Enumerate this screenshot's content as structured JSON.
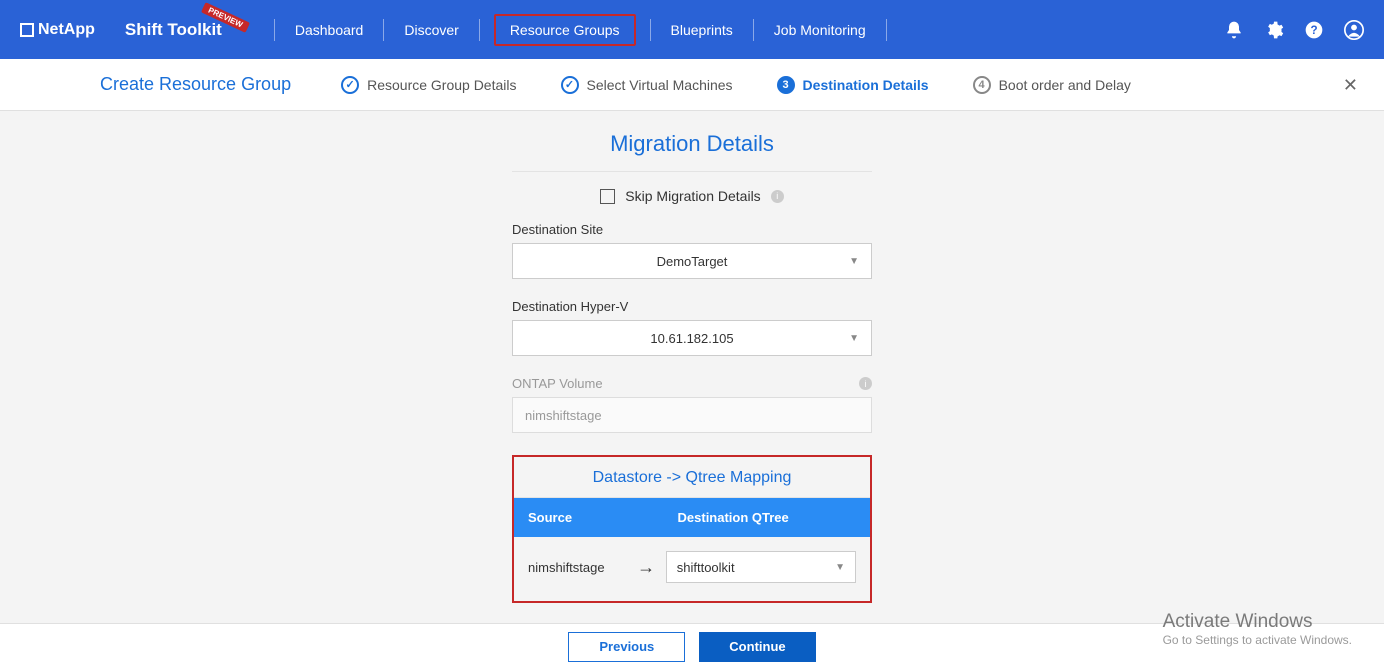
{
  "brand": {
    "company": "NetApp",
    "product": "Shift Toolkit",
    "ribbon": "PREVIEW"
  },
  "nav": {
    "dashboard": "Dashboard",
    "discover": "Discover",
    "resource_groups": "Resource Groups",
    "blueprints": "Blueprints",
    "job_monitoring": "Job Monitoring"
  },
  "wizard": {
    "title": "Create Resource Group",
    "steps": {
      "s1": "Resource Group Details",
      "s2": "Select Virtual Machines",
      "s3": "Destination Details",
      "s4": "Boot order and Delay",
      "n3": "3",
      "n4": "4"
    }
  },
  "panel": {
    "heading": "Migration Details",
    "skip_label": "Skip Migration Details",
    "dest_site_label": "Destination Site",
    "dest_site_value": "DemoTarget",
    "dest_hv_label": "Destination Hyper-V",
    "dest_hv_value": "10.61.182.105",
    "ontap_label": "ONTAP Volume",
    "ontap_value": "nimshiftstage"
  },
  "mapping": {
    "title": "Datastore -> Qtree Mapping",
    "col_source": "Source",
    "col_dest": "Destination QTree",
    "rows": [
      {
        "source": "nimshiftstage",
        "dest": "shifttoolkit"
      }
    ]
  },
  "buttons": {
    "previous": "Previous",
    "continue": "Continue"
  },
  "watermark": {
    "title": "Activate Windows",
    "sub": "Go to Settings to activate Windows."
  }
}
